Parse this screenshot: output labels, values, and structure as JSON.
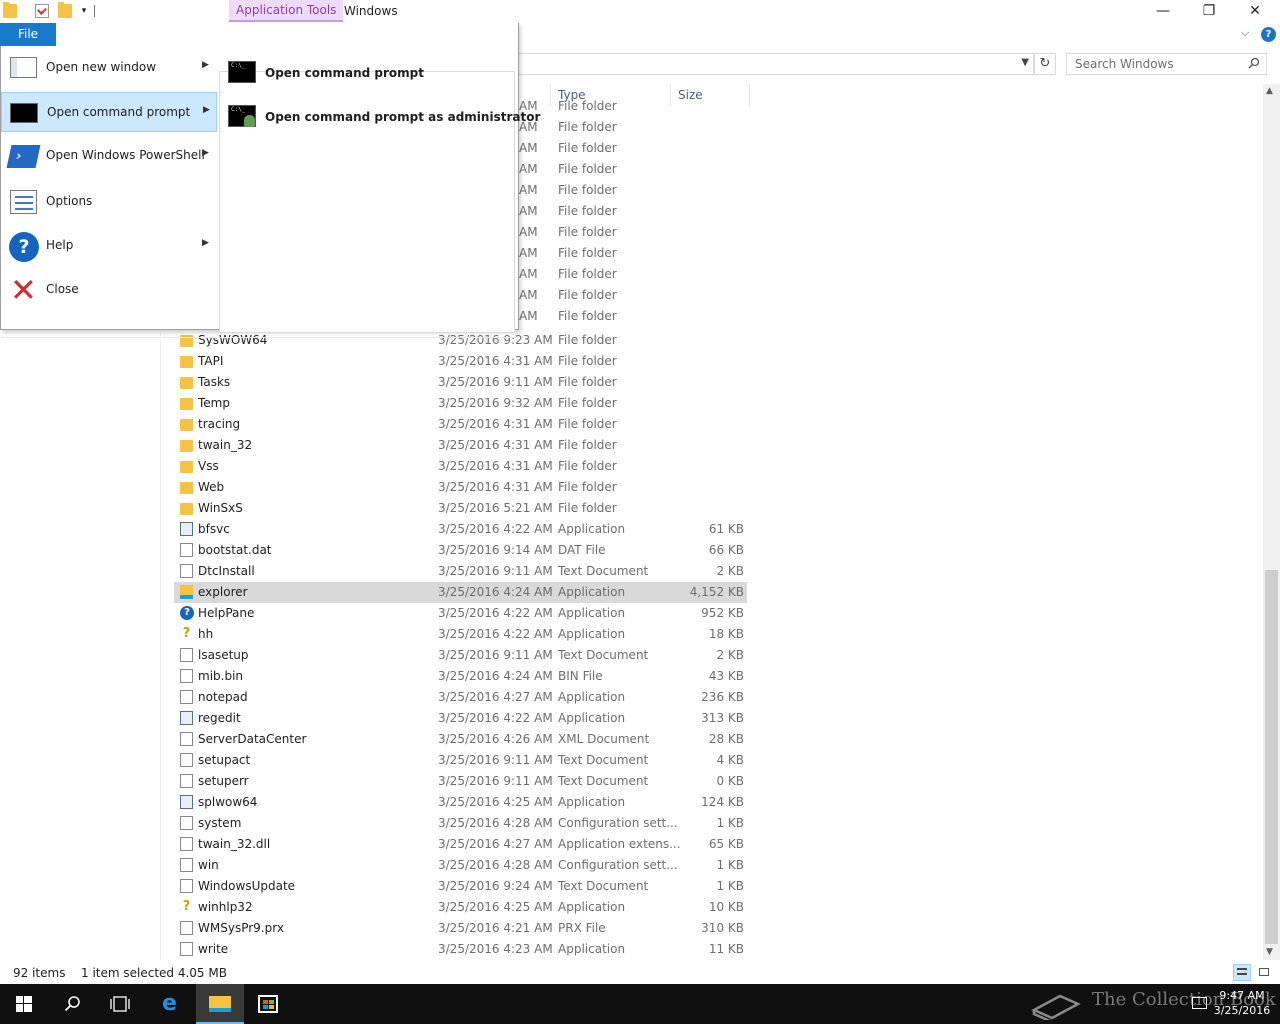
{
  "titlebar": {
    "context_tab": "Application Tools",
    "title": "Windows",
    "minimize": "—",
    "restore": "❐",
    "close": "✕"
  },
  "ribbon": {
    "file_tab": "File",
    "collapse": "⌵",
    "help": "?"
  },
  "address": {
    "refresh": "↻"
  },
  "search": {
    "placeholder": "Search Windows"
  },
  "columns": {
    "type": "Type",
    "size": "Size"
  },
  "hidden_rows_types": [
    "File folder",
    "File folder",
    "File folder",
    "File folder",
    "File folder",
    "File folder",
    "File folder",
    "File folder",
    "File folder",
    "File folder",
    "File folder"
  ],
  "hidden_rows_dates": [
    "AM",
    "AM",
    "AM",
    "AM",
    "AM",
    "AM",
    "AM",
    "AM",
    "AM",
    "AM",
    "AM"
  ],
  "files": [
    {
      "name": "SysWOW64",
      "date": "3/25/2016 9:23 AM",
      "type": "File folder",
      "size": "",
      "icon": "folder-icon"
    },
    {
      "name": "TAPI",
      "date": "3/25/2016 4:31 AM",
      "type": "File folder",
      "size": "",
      "icon": "folder-icon"
    },
    {
      "name": "Tasks",
      "date": "3/25/2016 9:11 AM",
      "type": "File folder",
      "size": "",
      "icon": "folder-icon"
    },
    {
      "name": "Temp",
      "date": "3/25/2016 9:32 AM",
      "type": "File folder",
      "size": "",
      "icon": "folder-icon"
    },
    {
      "name": "tracing",
      "date": "3/25/2016 4:31 AM",
      "type": "File folder",
      "size": "",
      "icon": "folder-icon"
    },
    {
      "name": "twain_32",
      "date": "3/25/2016 4:31 AM",
      "type": "File folder",
      "size": "",
      "icon": "folder-icon"
    },
    {
      "name": "Vss",
      "date": "3/25/2016 4:31 AM",
      "type": "File folder",
      "size": "",
      "icon": "folder-icon"
    },
    {
      "name": "Web",
      "date": "3/25/2016 4:31 AM",
      "type": "File folder",
      "size": "",
      "icon": "folder-icon"
    },
    {
      "name": "WinSxS",
      "date": "3/25/2016 5:21 AM",
      "type": "File folder",
      "size": "",
      "icon": "folder-icon"
    },
    {
      "name": "bfsvc",
      "date": "3/25/2016 4:22 AM",
      "type": "Application",
      "size": "61 KB",
      "icon": "app-icon"
    },
    {
      "name": "bootstat.dat",
      "date": "3/25/2016 9:14 AM",
      "type": "DAT File",
      "size": "66 KB",
      "icon": "document-icon"
    },
    {
      "name": "DtcInstall",
      "date": "3/25/2016 9:11 AM",
      "type": "Text Document",
      "size": "2 KB",
      "icon": "document-icon"
    },
    {
      "name": "explorer",
      "date": "3/25/2016 4:24 AM",
      "type": "Application",
      "size": "4,152 KB",
      "icon": "explorer-icon",
      "selected": true
    },
    {
      "name": "HelpPane",
      "date": "3/25/2016 4:22 AM",
      "type": "Application",
      "size": "952 KB",
      "icon": "help-icon"
    },
    {
      "name": "hh",
      "date": "3/25/2016 4:22 AM",
      "type": "Application",
      "size": "18 KB",
      "icon": "help-question-icon"
    },
    {
      "name": "lsasetup",
      "date": "3/25/2016 9:11 AM",
      "type": "Text Document",
      "size": "2 KB",
      "icon": "document-icon"
    },
    {
      "name": "mib.bin",
      "date": "3/25/2016 4:24 AM",
      "type": "BIN File",
      "size": "43 KB",
      "icon": "document-icon"
    },
    {
      "name": "notepad",
      "date": "3/25/2016 4:27 AM",
      "type": "Application",
      "size": "236 KB",
      "icon": "notepad-icon"
    },
    {
      "name": "regedit",
      "date": "3/25/2016 4:22 AM",
      "type": "Application",
      "size": "313 KB",
      "icon": "regedit-icon"
    },
    {
      "name": "ServerDataCenter",
      "date": "3/25/2016 4:26 AM",
      "type": "XML Document",
      "size": "28 KB",
      "icon": "xml-icon"
    },
    {
      "name": "setupact",
      "date": "3/25/2016 9:11 AM",
      "type": "Text Document",
      "size": "4 KB",
      "icon": "document-icon"
    },
    {
      "name": "setuperr",
      "date": "3/25/2016 9:11 AM",
      "type": "Text Document",
      "size": "0 KB",
      "icon": "document-icon"
    },
    {
      "name": "splwow64",
      "date": "3/25/2016 4:25 AM",
      "type": "Application",
      "size": "124 KB",
      "icon": "printer-icon"
    },
    {
      "name": "system",
      "date": "3/25/2016 4:28 AM",
      "type": "Configuration sett...",
      "size": "1 KB",
      "icon": "config-icon"
    },
    {
      "name": "twain_32.dll",
      "date": "3/25/2016 4:27 AM",
      "type": "Application extens...",
      "size": "65 KB",
      "icon": "dll-icon"
    },
    {
      "name": "win",
      "date": "3/25/2016 4:28 AM",
      "type": "Configuration sett...",
      "size": "1 KB",
      "icon": "config-icon"
    },
    {
      "name": "WindowsUpdate",
      "date": "3/25/2016 9:24 AM",
      "type": "Text Document",
      "size": "1 KB",
      "icon": "document-icon"
    },
    {
      "name": "winhlp32",
      "date": "3/25/2016 4:25 AM",
      "type": "Application",
      "size": "10 KB",
      "icon": "help-question-icon"
    },
    {
      "name": "WMSysPr9.prx",
      "date": "3/25/2016 4:21 AM",
      "type": "PRX File",
      "size": "310 KB",
      "icon": "document-icon"
    },
    {
      "name": "write",
      "date": "3/25/2016 4:23 AM",
      "type": "Application",
      "size": "11 KB",
      "icon": "write-icon"
    }
  ],
  "file_menu": {
    "items": [
      {
        "label": "Open new window",
        "icon": "new-window-icon",
        "arrow": "▶"
      },
      {
        "label": "Open command prompt",
        "icon": "cmd-icon",
        "arrow": "▶",
        "highlighted": true
      },
      {
        "label": "Open Windows PowerShell",
        "icon": "powershell-icon",
        "arrow": "▶"
      },
      {
        "label": "Options",
        "icon": "options-icon"
      },
      {
        "label": "Help",
        "icon": "help-icon",
        "arrow": "▶"
      },
      {
        "label": "Close",
        "icon": "close-icon"
      }
    ],
    "submenu": [
      {
        "label": "Open command prompt",
        "icon": "cmd-icon"
      },
      {
        "label": "Open command prompt as administrator",
        "icon": "cmd-admin-icon"
      }
    ]
  },
  "status": {
    "count": "92 items",
    "selection": "1 item selected  4.05 MB"
  },
  "taskbar": {
    "time": "9:47 AM",
    "date": "3/25/2016",
    "watermark": "The Collection Book"
  },
  "colors": {
    "accent": "#1979ca",
    "menu_highlight": "#cce8ff",
    "context_tab": "#eedcf6",
    "folder": "#f6c244"
  }
}
